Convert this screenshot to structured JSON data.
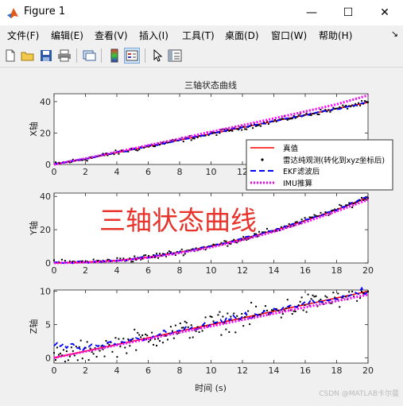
{
  "window": {
    "title": "Figure 1",
    "minimize": "—",
    "maximize": "☐",
    "close": "✕"
  },
  "menu": {
    "items": [
      "文件(F)",
      "编辑(E)",
      "查看(V)",
      "插入(I)",
      "工具(T)",
      "桌面(D)",
      "窗口(W)",
      "帮助(H)"
    ],
    "overflow": "↘"
  },
  "toolbar": {
    "icons": [
      "new-figure-icon",
      "open-file-icon",
      "save-icon",
      "print-icon",
      "link-plot-icon",
      "colorbar-icon",
      "legend-icon",
      "pointer-icon",
      "property-inspector-icon"
    ]
  },
  "figure": {
    "title": "三轴状态曲线",
    "overlay_text": "三轴状态曲线",
    "xlabel": "时间 (s)",
    "watermark": "CSDN @MATLAB卡尔曼"
  },
  "legend": {
    "entries": [
      {
        "label": "真值",
        "color": "#ff0000",
        "style": "solid"
      },
      {
        "label": "雷达纯观测(转化到xyz坐标后)",
        "color": "#000000",
        "style": "dot"
      },
      {
        "label": "EKF滤波后",
        "color": "#0000ff",
        "style": "dashed"
      },
      {
        "label": "IMU推算",
        "color": "#ff00ff",
        "style": "dotted"
      }
    ]
  },
  "chart_data": [
    {
      "type": "line",
      "ylabel": "X轴",
      "xlim": [
        0,
        20
      ],
      "ylim": [
        0,
        45
      ],
      "xticks": [
        0,
        2,
        4,
        6,
        8,
        10,
        12,
        14,
        16,
        18,
        20
      ],
      "yticks": [
        0,
        20,
        40
      ],
      "grid": false,
      "legend_position": "right, outside lower edge of top axes",
      "x": [
        0,
        2,
        4,
        6,
        8,
        10,
        12,
        14,
        16,
        18,
        20
      ],
      "series": [
        {
          "name": "真值",
          "values": [
            0,
            3.5,
            7.5,
            11.5,
            15.5,
            19.5,
            23.5,
            27.5,
            31.5,
            35.5,
            39.5
          ]
        },
        {
          "name": "雷达纯观测(转化到xyz坐标后)",
          "values": [
            0,
            3.5,
            7.5,
            11.5,
            15.5,
            19.5,
            23.5,
            27.5,
            31.5,
            35.5,
            39.5
          ],
          "noise": 1.2
        },
        {
          "name": "EKF滤波后",
          "values": [
            0,
            3.6,
            7.6,
            11.6,
            15.5,
            19.6,
            23.8,
            27.6,
            31.6,
            35.4,
            39.5
          ]
        },
        {
          "name": "IMU推算",
          "values": [
            0,
            3.8,
            8.0,
            12.2,
            16.4,
            20.8,
            25.0,
            29.3,
            33.7,
            38.3,
            44.0
          ]
        }
      ]
    },
    {
      "type": "line",
      "ylabel": "Y轴",
      "xlim": [
        0,
        20
      ],
      "ylim": [
        0,
        42
      ],
      "xticks": [
        0,
        2,
        4,
        6,
        8,
        10,
        12,
        14,
        16,
        18,
        20
      ],
      "yticks": [
        0,
        20,
        40
      ],
      "grid": false,
      "x": [
        0,
        2,
        4,
        6,
        8,
        10,
        12,
        14,
        16,
        18,
        20
      ],
      "series": [
        {
          "name": "真值",
          "values": [
            0,
            0.5,
            1.5,
            3.5,
            6.5,
            10,
            14.5,
            19.5,
            25.5,
            32,
            39.5
          ]
        },
        {
          "name": "雷达纯观测(转化到xyz坐标后)",
          "values": [
            0,
            0.5,
            1.5,
            3.5,
            6.5,
            10,
            14.5,
            19.5,
            25.5,
            32,
            39.5
          ],
          "noise": 1.5
        },
        {
          "name": "EKF滤波后",
          "values": [
            0.3,
            0.6,
            1.5,
            3.6,
            6.5,
            10.1,
            14.6,
            19.6,
            25.5,
            32.1,
            39.8
          ]
        },
        {
          "name": "IMU推算",
          "values": [
            0,
            0.4,
            1.3,
            3.2,
            6.0,
            9.4,
            13.8,
            18.8,
            24.6,
            31.0,
            38.0
          ]
        }
      ]
    },
    {
      "type": "line",
      "ylabel": "Z轴",
      "xlim": [
        0,
        20
      ],
      "ylim": [
        -0.8,
        10.2
      ],
      "xticks": [
        0,
        2,
        4,
        6,
        8,
        10,
        12,
        14,
        16,
        18,
        20
      ],
      "yticks": [
        0,
        5,
        10
      ],
      "grid": false,
      "x": [
        0,
        2,
        4,
        6,
        8,
        10,
        12,
        14,
        16,
        18,
        20
      ],
      "series": [
        {
          "name": "真值",
          "values": [
            0,
            1,
            2,
            3,
            4,
            5,
            6,
            7,
            8,
            9,
            10
          ]
        },
        {
          "name": "雷达纯观测(转化到xyz坐标后)",
          "values": [
            0,
            1,
            2,
            3,
            4,
            5,
            6,
            7,
            8,
            9,
            10
          ],
          "noise": 1.3
        },
        {
          "name": "EKF滤波后",
          "values": [
            2.0,
            1.3,
            2.2,
            3.1,
            4.0,
            5.0,
            6.1,
            7.0,
            8.1,
            9.0,
            10.0
          ]
        },
        {
          "name": "IMU推算",
          "values": [
            0,
            0.95,
            1.9,
            2.85,
            3.8,
            4.75,
            5.7,
            6.65,
            7.6,
            8.55,
            9.5
          ]
        }
      ]
    }
  ],
  "colors": {
    "truth": "#ff0000",
    "radar": "#000000",
    "ekf": "#0000ff",
    "imu": "#ff00ff",
    "overlay": "#e8322a",
    "titlebar": "#ffffff",
    "chrome": "#f0f0f0"
  }
}
